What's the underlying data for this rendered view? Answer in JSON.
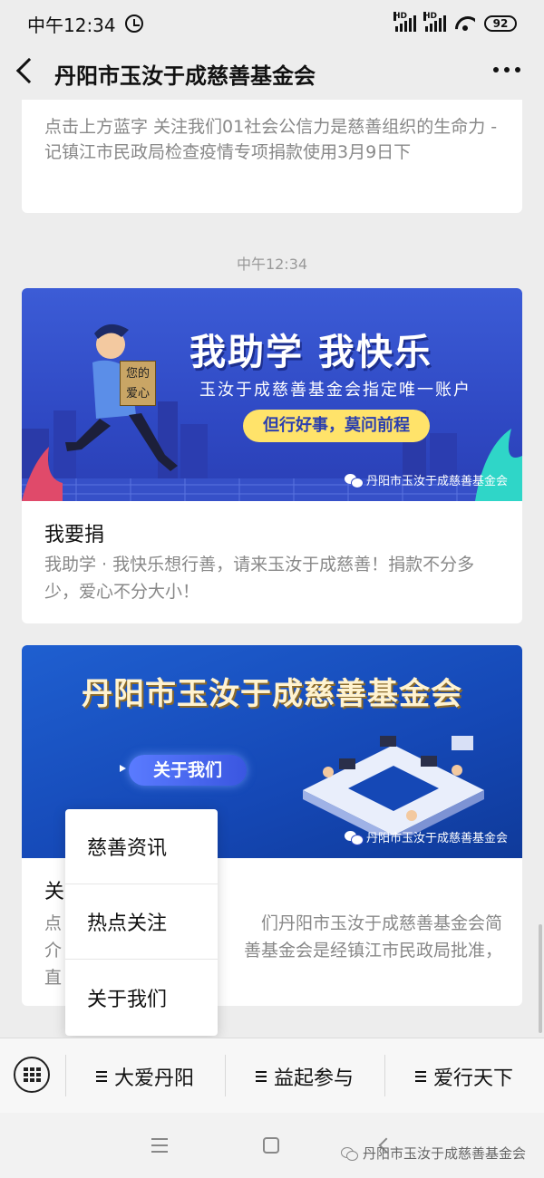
{
  "status_bar": {
    "time": "中午12:34",
    "signal_label_1": "HD",
    "signal_label_2": "HD",
    "battery": "92"
  },
  "nav": {
    "title": "丹阳市玉汝于成慈善基金会"
  },
  "message_time": "中午12:34",
  "articles": [
    {
      "description": "点击上方蓝字  关注我们01社会公信力是慈善组织的生命力   -记镇江市民政局检查疫情专项捐款使用3月9日下"
    },
    {
      "banner_title": "我助学 我快乐",
      "banner_subtitle": "玉汝于成慈善基金会指定唯一账户",
      "banner_pill": "但行好事，莫问前程",
      "banner_sign": "您的爱心",
      "banner_brand": "丹阳市玉汝于成慈善基金会",
      "title": "我要捐",
      "description": "我助学 · 我快乐想行善，请来玉汝于成慈善！捐款不分多少，爱心不分大小！"
    },
    {
      "banner_title": "丹阳市玉汝于成慈善基金会",
      "banner_button": "关于我们",
      "banner_brand": "丹阳市玉汝于成慈善基金会",
      "title": "关",
      "description_line1": "点",
      "description_line1_tail": "们丹阳市玉汝于成慈善基金会简",
      "description_line2": "介",
      "description_line2_tail": "善基金会是经镇江市民政局批准，",
      "description_line3": "直"
    }
  ],
  "popup_menu": {
    "items": [
      "慈善资讯",
      "热点关注",
      "关于我们"
    ]
  },
  "bottom_menu": {
    "items": [
      "大爱丹阳",
      "益起参与",
      "爱行天下"
    ]
  },
  "watermark": "丹阳市玉汝于成慈善基金会",
  "colors": {
    "background": "#ededed",
    "banner1": "#3c5cd6",
    "banner2": "#1f5fd0",
    "pill": "#ffe36a"
  }
}
